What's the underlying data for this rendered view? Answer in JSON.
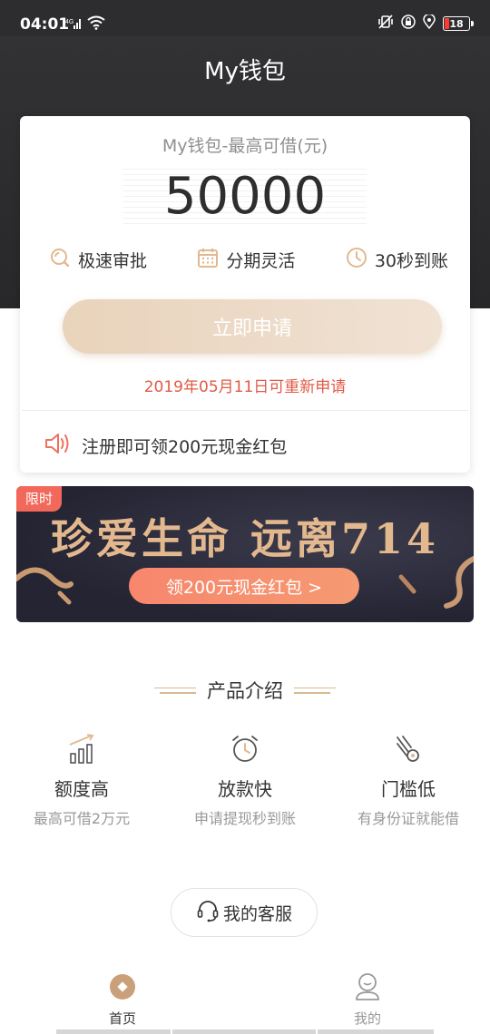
{
  "status_bar": {
    "time": "04:01",
    "signal_label": "4G",
    "battery_level": "18",
    "icons": [
      "signal-icon",
      "wifi-icon",
      "vibrate-icon",
      "lock-icon",
      "location-icon",
      "battery-icon"
    ]
  },
  "header": {
    "title": "My钱包"
  },
  "card": {
    "label": "My钱包-最高可借(元)",
    "amount": "50000",
    "features": [
      {
        "label": "极速审批",
        "icon": "search-icon"
      },
      {
        "label": "分期灵活",
        "icon": "calendar-icon"
      },
      {
        "label": "30秒到账",
        "icon": "clock-icon"
      }
    ],
    "apply_label": "立即申请",
    "reapply_text": "2019年05月11日可重新申请",
    "notice": "注册即可领200元现金红包",
    "notice_icon": "speaker-icon"
  },
  "banner": {
    "tag": "限时",
    "headline": "珍爱生命 远离714",
    "button_label": "领200元现金红包 >"
  },
  "products_section": {
    "title": "产品介绍",
    "items": [
      {
        "title": "额度高",
        "desc": "最高可借2万元",
        "icon": "chart-bars-icon"
      },
      {
        "title": "放款快",
        "desc": "申请提现秒到账",
        "icon": "alarm-clock-icon"
      },
      {
        "title": "门槛低",
        "desc": "有身份证就能借",
        "icon": "meteor-icon"
      }
    ]
  },
  "service": {
    "label": "我的客服",
    "icon": "headset-icon"
  },
  "tabbar": {
    "items": [
      {
        "label": "首页",
        "icon": "home-icon",
        "active": true
      },
      {
        "label": "我的",
        "icon": "user-icon",
        "active": false
      }
    ]
  },
  "colors": {
    "header_bg": "#2d2d2f",
    "accent_gold": "#e3b88e",
    "reapply_red": "#e05a47",
    "banner_button": "#f7866d",
    "tag_red": "#f2685a"
  }
}
